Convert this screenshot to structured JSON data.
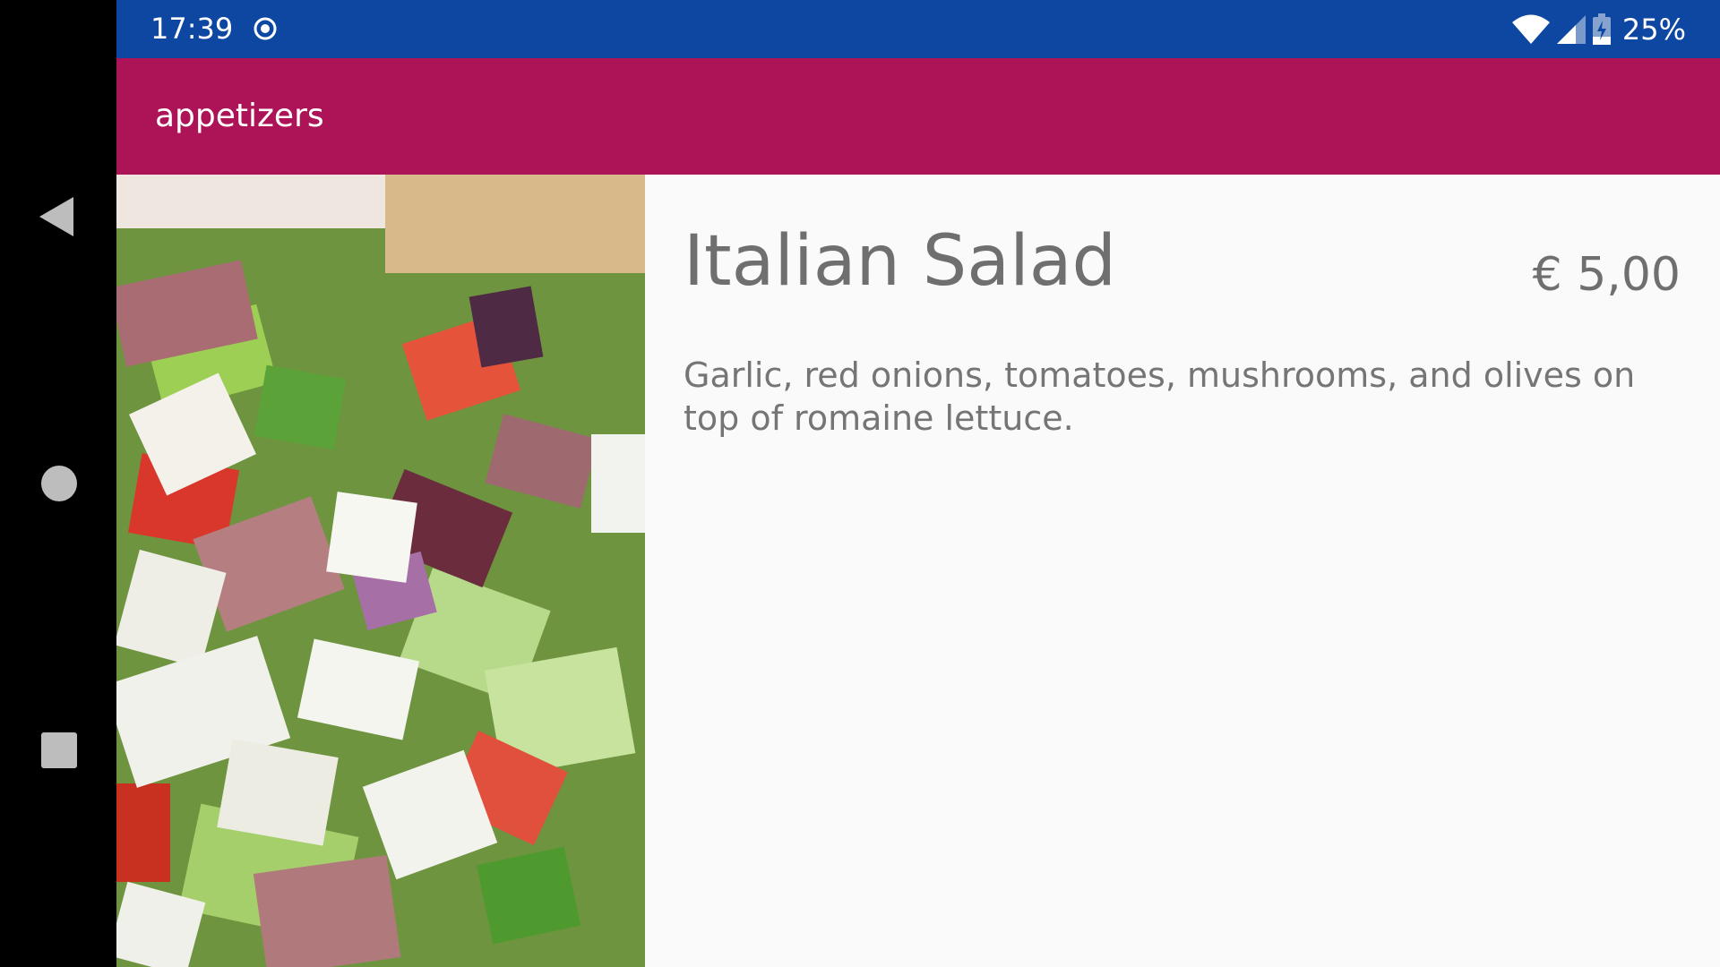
{
  "status_bar": {
    "time": "17:39",
    "battery_percent": "25%",
    "icons": [
      "record-icon",
      "wifi-icon",
      "signal-icon",
      "battery-icon"
    ],
    "color": "#0d47a1"
  },
  "app_bar": {
    "title": "appetizers",
    "color": "#ad1457"
  },
  "nav_bar": {
    "buttons": [
      "back-button",
      "home-button",
      "recents-button"
    ]
  },
  "item": {
    "image": "italian-salad-photo",
    "name": "Italian Salad",
    "price": "€ 5,00",
    "description": "Garlic, red onions, tomatoes, mushrooms, and olives on top of romaine lettuce."
  }
}
